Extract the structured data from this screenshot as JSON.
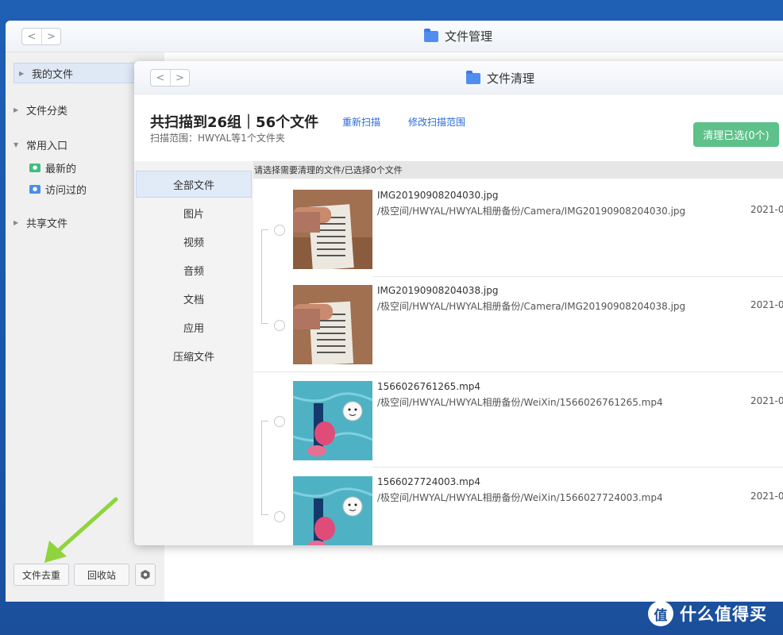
{
  "outer_window": {
    "title": "文件管理",
    "nav": {
      "back": "<",
      "forward": ">"
    }
  },
  "sidebar": {
    "my_files": "我的文件",
    "file_categories": "文件分类",
    "quick_access": "常用入口",
    "recent": "最新的",
    "visited": "访问过的",
    "shared_files": "共享文件",
    "dedupe_button": "文件去重",
    "recycle_button": "回收站"
  },
  "inner_window": {
    "title": "文件清理",
    "nav": {
      "back": "<",
      "forward": ">"
    },
    "scan_title": "共扫描到26组｜56个文件",
    "scan_scope": "扫描范围：HWYAL等1个文件夹",
    "rescan_link": "重新扫描",
    "modify_scope_link": "修改扫描范围",
    "clean_button": "清理已选(0个)",
    "list_header": "请选择需要清理的文件/已选择0个文件",
    "categories": [
      "全部文件",
      "图片",
      "视频",
      "音频",
      "文档",
      "应用",
      "压缩文件"
    ],
    "files": [
      {
        "name": "IMG20190908204030.jpg",
        "path": "/极空间/HWYAL/HWYAL相册备份/Camera/IMG20190908204030.jpg",
        "date": "2021-0"
      },
      {
        "name": "IMG20190908204038.jpg",
        "path": "/极空间/HWYAL/HWYAL相册备份/Camera/IMG20190908204038.jpg",
        "date": "2021-0"
      },
      {
        "name": "1566026761265.mp4",
        "path": "/极空间/HWYAL/HWYAL相册备份/WeiXin/1566026761265.mp4",
        "date": "2021-0"
      },
      {
        "name": "1566027724003.mp4",
        "path": "/极空间/HWYAL/HWYAL相册备份/WeiXin/1566027724003.mp4",
        "date": "2021-0"
      }
    ]
  },
  "watermark": {
    "logo": "值",
    "text": "什么值得买"
  },
  "colors": {
    "accent": "#2b6ad8",
    "clean_button": "#5ec189",
    "desktop": "#1b56a6",
    "annotation_arrow": "#8fd43c"
  }
}
